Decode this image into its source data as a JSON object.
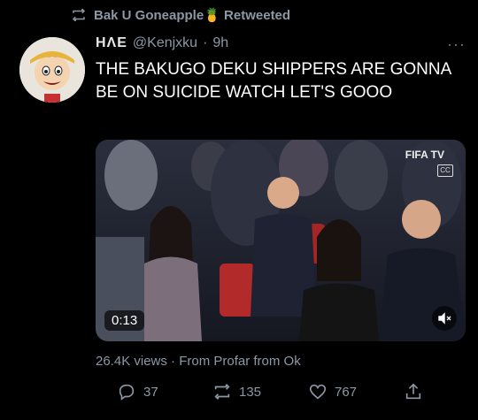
{
  "retweet": {
    "text": "Bak U Goneapple🍍 Retweeted"
  },
  "tweet": {
    "name": "HΛE",
    "handle": "@Kenjxku",
    "separator": "·",
    "time": "9h",
    "more": "···",
    "text": "THE BAKUGO DEKU SHIPPERS ARE GONNA BE ON SUICIDE WATCH LET'S GOOO"
  },
  "media": {
    "watermark": "FIFA TV",
    "cc_label": "CC",
    "timestamp": "0:13"
  },
  "meta": {
    "views_line": "26.4K views · From Profar from Ok"
  },
  "actions": {
    "replies": "37",
    "retweets": "135",
    "likes": "767"
  }
}
